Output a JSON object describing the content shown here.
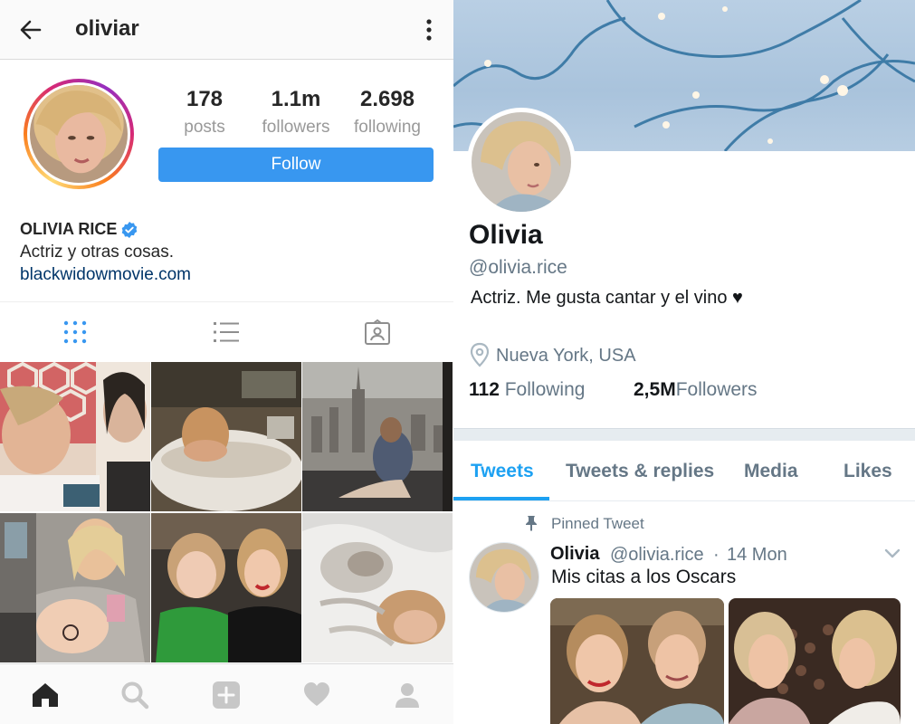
{
  "instagram": {
    "header": {
      "username": "oliviar"
    },
    "stats": [
      {
        "value": "178",
        "label": "posts"
      },
      {
        "value": "1.1m",
        "label": "followers"
      },
      {
        "value": "2.698",
        "label": "following"
      }
    ],
    "follow_label": "Follow",
    "profile": {
      "name": "OLIVIA RICE",
      "bio": "Actriz y otras cosas.",
      "link": "blackwidowmovie.com"
    },
    "colors": {
      "accent": "#3897f0",
      "link": "#003569"
    }
  },
  "twitter": {
    "profile": {
      "name": "Olivia",
      "handle": "@olivia.rice",
      "bio": "Actriz. Me gusta cantar y el vino ♥",
      "location": "Nueva York, USA"
    },
    "counts": {
      "following_value": "112",
      "following_label": " Following",
      "followers_value": "2,5M",
      "followers_label": "Followers"
    },
    "tabs": [
      "Tweets",
      "Tweets & replies",
      "Media",
      "Likes"
    ],
    "pinned": {
      "label": "Pinned Tweet",
      "name": "Olivia",
      "handle": "@olivia.rice",
      "dot": "·",
      "time": "14 Mon",
      "text": "Mis citas a los Oscars"
    },
    "colors": {
      "accent": "#1da1f2",
      "secondary_text": "#657786"
    }
  }
}
